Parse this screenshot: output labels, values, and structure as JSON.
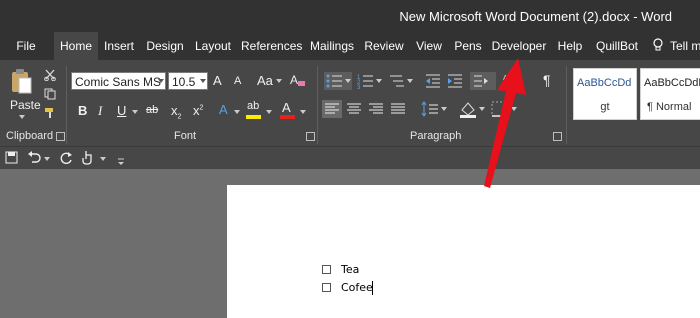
{
  "window": {
    "title": "New Microsoft Word Document (2).docx  -  Word"
  },
  "tabs": [
    {
      "label": "File"
    },
    {
      "label": "Home"
    },
    {
      "label": "Insert"
    },
    {
      "label": "Design"
    },
    {
      "label": "Layout"
    },
    {
      "label": "References"
    },
    {
      "label": "Mailings"
    },
    {
      "label": "Review"
    },
    {
      "label": "View"
    },
    {
      "label": "Pens"
    },
    {
      "label": "Developer"
    },
    {
      "label": "Help"
    },
    {
      "label": "QuillBot"
    },
    {
      "label": "Tell m"
    }
  ],
  "clipboard": {
    "paste_label": "Paste",
    "group_label": "Clipboard"
  },
  "font": {
    "name": "Comic Sans MS",
    "size": "10.5",
    "group_label": "Font",
    "grow": "A",
    "shrink": "A",
    "case": "Aa",
    "bold": "B",
    "italic": "I",
    "underline": "U",
    "strike": "ab",
    "subscript": "x",
    "superscript": "x",
    "effects": "A",
    "highlight": "ab",
    "color": "A"
  },
  "paragraph": {
    "group_label": "Paragraph",
    "pilcrow": "¶"
  },
  "styles": [
    {
      "preview": "AaBbCcDd",
      "name": "gt"
    },
    {
      "preview": "AaBbCcDdE",
      "name": "¶ Normal"
    }
  ],
  "document": {
    "items": [
      {
        "text": "Tea"
      },
      {
        "text": "Cofee"
      }
    ]
  },
  "colors": {
    "accent_arrow": "#e8101a",
    "highlight_yellow": "#ffeb00",
    "font_red": "#e82020"
  }
}
